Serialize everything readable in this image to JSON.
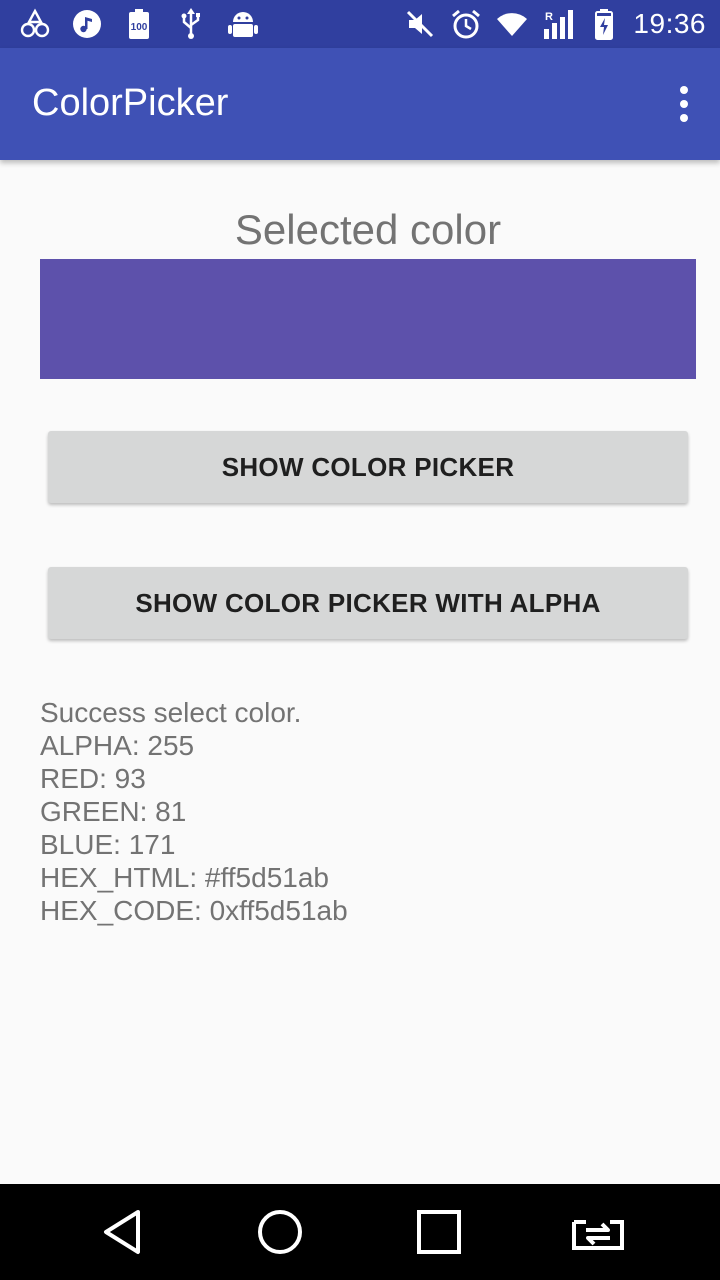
{
  "status_bar": {
    "time": "19:36",
    "left_icons": [
      "notification-icon",
      "music-icon",
      "battery-saver-icon",
      "usb-icon",
      "android-debug-icon"
    ],
    "right_icons": [
      "mute-icon",
      "alarm-icon",
      "wifi-icon",
      "signal-icon",
      "battery-charging-icon"
    ]
  },
  "app_bar": {
    "title": "ColorPicker",
    "overflow_icon": "more-vert-icon"
  },
  "content": {
    "heading": "Selected color",
    "selected_color": "#5d51ab",
    "buttons": {
      "show_picker": "SHOW COLOR PICKER",
      "show_picker_alpha": "SHOW COLOR PICKER WITH ALPHA"
    },
    "result_lines": [
      "Success select color.",
      "ALPHA: 255",
      "RED: 93",
      "GREEN: 81",
      "BLUE: 171",
      "HEX_HTML: #ff5d51ab",
      "HEX_CODE: 0xff5d51ab"
    ]
  },
  "nav_bar": {
    "icons": [
      "back-icon",
      "home-icon",
      "recents-icon",
      "switch-app-icon"
    ]
  },
  "colors": {
    "status_bar": "#303f9f",
    "app_bar": "#3f51b5",
    "background": "#fafafa",
    "button": "#d6d7d7"
  }
}
